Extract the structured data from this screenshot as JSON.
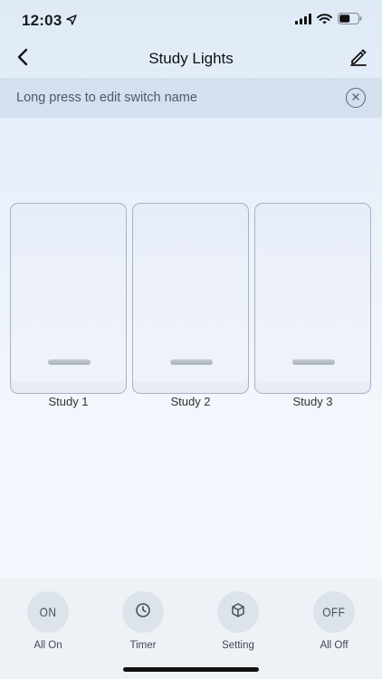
{
  "status_bar": {
    "time": "12:03",
    "icons": [
      "location-arrow-icon",
      "cellular-signal-icon",
      "wifi-icon",
      "battery-icon"
    ]
  },
  "nav": {
    "title": "Study Lights",
    "back_icon": "chevron-left-icon",
    "edit_icon": "pencil-icon"
  },
  "hint": {
    "text": "Long press to edit switch name",
    "close_icon": "close-circle-icon"
  },
  "switches": [
    {
      "label": "Study 1",
      "state": "off"
    },
    {
      "label": "Study 2",
      "state": "off"
    },
    {
      "label": "Study 3",
      "state": "off"
    }
  ],
  "actions": [
    {
      "icon_text": "ON",
      "label": "All On"
    },
    {
      "icon": "clock-icon",
      "label": "Timer"
    },
    {
      "icon": "cube-icon",
      "label": "Setting"
    },
    {
      "icon_text": "OFF",
      "label": "All Off"
    }
  ],
  "colors": {
    "background_top": "#dfeaf7",
    "hint_bar": "#c8d6e6",
    "bottom_bar": "#eef2f6",
    "action_circle": "#dde3ea"
  }
}
